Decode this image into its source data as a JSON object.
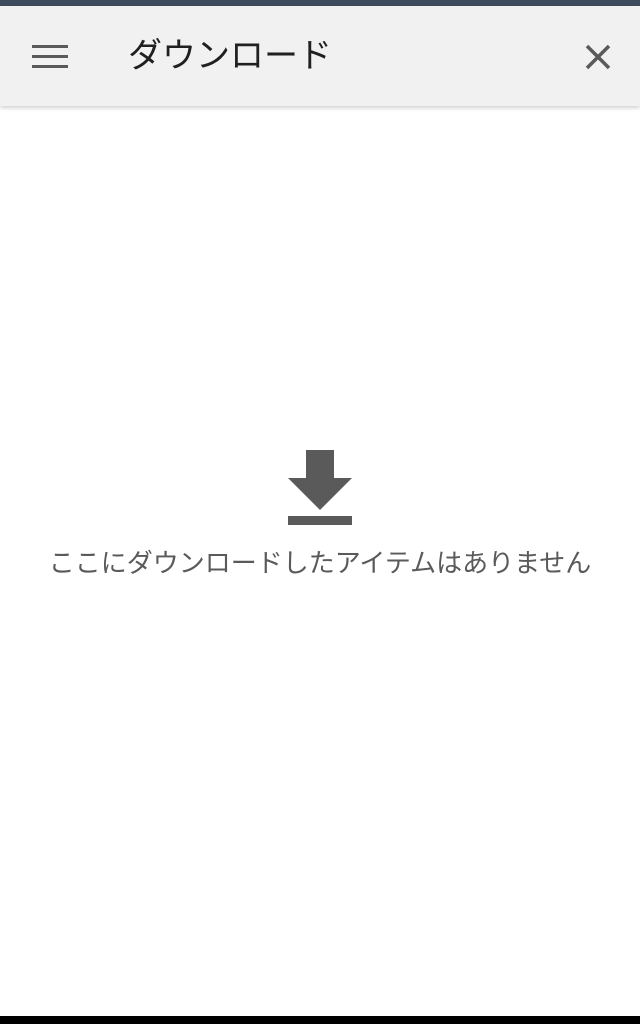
{
  "app_bar": {
    "title": "ダウンロード",
    "menu_icon": "menu-icon",
    "close_icon": "close-icon"
  },
  "empty_state": {
    "icon": "download-icon",
    "message": "ここにダウンロードしたアイテムはありません"
  },
  "colors": {
    "status_bar": "#3d4b5c",
    "app_bar_bg": "#f1f1f1",
    "title_text": "#202020",
    "icon_gray": "#5a5a5a",
    "body_bg": "#ffffff"
  }
}
